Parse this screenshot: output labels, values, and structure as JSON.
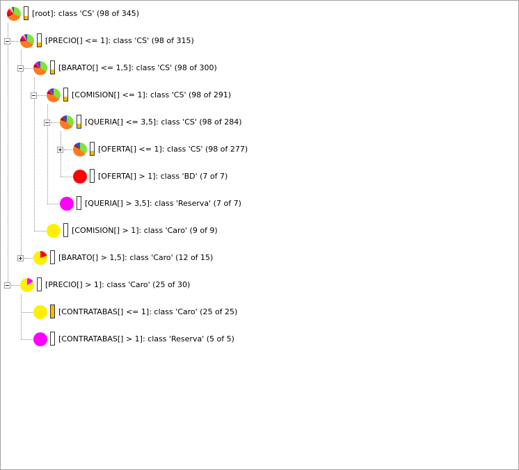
{
  "colors": {
    "CS": "#ffb800",
    "BD": "#ff0000",
    "Reserva": "#ff00ff",
    "Caro": "#ffef00",
    "pie_green": "#7fe33a",
    "pie_orange": "#ff7a1a",
    "pie_blue": "#3a48c8",
    "pie_darkred": "#8b1a1a"
  },
  "tree": {
    "nodes": [
      {
        "id": "root",
        "label": "[root]:  class 'CS' (98 of 345)",
        "pie_icon": "pie-chart-icon",
        "bar_level": 0.284,
        "bar_color": "#ffb800",
        "pie": [
          [
            "#7fe33a",
            0.31
          ],
          [
            "#ff7a1a",
            0.37
          ],
          [
            "#8b1a1a",
            0.05
          ],
          [
            "#ff0000",
            0.12
          ],
          [
            "#ff00ff",
            0.04
          ],
          [
            "#ffef00",
            0.06
          ],
          [
            "#3a48c8",
            0.05
          ]
        ]
      },
      {
        "id": "precio-le-1",
        "label": "[PRECIO[] <= 1]:  class 'CS' (98 of 315)",
        "pie_icon": "pie-chart-icon",
        "bar_level": 0.311,
        "bar_color": "#ffb800",
        "pie": [
          [
            "#7fe33a",
            0.32
          ],
          [
            "#ff7a1a",
            0.42
          ],
          [
            "#8b1a1a",
            0.06
          ],
          [
            "#ff0000",
            0.05
          ],
          [
            "#ff00ff",
            0.05
          ],
          [
            "#ffef00",
            0.03
          ],
          [
            "#3a48c8",
            0.07
          ]
        ]
      },
      {
        "id": "barato-le-15",
        "label": "[BARATO[] <= 1,5]:  class 'CS' (98 of 300)",
        "pie_icon": "pie-chart-icon",
        "bar_level": 0.327,
        "bar_color": "#ffb800",
        "pie": [
          [
            "#7fe33a",
            0.33
          ],
          [
            "#ff7a1a",
            0.44
          ],
          [
            "#8b1a1a",
            0.06
          ],
          [
            "#ff0000",
            0.03
          ],
          [
            "#ff00ff",
            0.05
          ],
          [
            "#3a48c8",
            0.09
          ]
        ]
      },
      {
        "id": "comision-le-1",
        "label": "[COMISION[] <= 1]:  class 'CS' (98 of 291)",
        "pie_icon": "pie-chart-icon",
        "bar_level": 0.337,
        "bar_color": "#ffb800",
        "pie": [
          [
            "#7fe33a",
            0.34
          ],
          [
            "#ff7a1a",
            0.45
          ],
          [
            "#8b1a1a",
            0.06
          ],
          [
            "#ff0000",
            0.03
          ],
          [
            "#ff00ff",
            0.03
          ],
          [
            "#3a48c8",
            0.09
          ]
        ]
      },
      {
        "id": "queria-le-35",
        "label": "[QUERIA[] <= 3,5]:  class 'CS' (98 of 284)",
        "pie_icon": "pie-chart-icon",
        "bar_level": 0.345,
        "bar_color": "#ffb800",
        "pie": [
          [
            "#7fe33a",
            0.35
          ],
          [
            "#ff7a1a",
            0.46
          ],
          [
            "#8b1a1a",
            0.06
          ],
          [
            "#ff0000",
            0.03
          ],
          [
            "#3a48c8",
            0.1
          ]
        ]
      },
      {
        "id": "oferta-le-1",
        "label": "[OFERTA[] <= 1]:  class 'CS' (98 of 277)",
        "pie_icon": "pie-chart-icon",
        "bar_level": 0.354,
        "bar_color": "#ffb800",
        "pie": [
          [
            "#7fe33a",
            0.36
          ],
          [
            "#ff7a1a",
            0.47
          ],
          [
            "#8b1a1a",
            0.06
          ],
          [
            "#3a48c8",
            0.11
          ]
        ]
      },
      {
        "id": "oferta-gt-1",
        "label": "[OFERTA[] > 1]:  class 'BD' (7 of 7)",
        "pie_icon": "pie-chart-icon",
        "bar_level": 0,
        "bar_color": "#ff0000",
        "pie": [
          [
            "#ff0000",
            1
          ]
        ]
      },
      {
        "id": "queria-gt-35",
        "label": "[QUERIA[] > 3,5]:  class 'Reserva' (7 of 7)",
        "pie_icon": "pie-chart-icon",
        "bar_level": 0,
        "bar_color": "#ff00ff",
        "pie": [
          [
            "#ff00ff",
            1
          ]
        ]
      },
      {
        "id": "comision-gt-1",
        "label": "[COMISION[] > 1]:  class 'Caro' (9 of 9)",
        "pie_icon": "pie-chart-icon",
        "bar_level": 0,
        "bar_color": "#ffef00",
        "pie": [
          [
            "#ffef00",
            1
          ]
        ]
      },
      {
        "id": "barato-gt-15",
        "label": "[BARATO[] > 1,5]:  class 'Caro' (12 of 15)",
        "pie_icon": "pie-chart-icon",
        "bar_level": 0,
        "bar_color": "#ffef00",
        "pie": [
          [
            "#ff0000",
            0.2
          ],
          [
            "#ffef00",
            0.8
          ]
        ]
      },
      {
        "id": "precio-gt-1",
        "label": "[PRECIO[] > 1]:  class 'Caro' (25 of 30)",
        "pie_icon": "pie-chart-icon",
        "bar_level": 0,
        "bar_color": "#ffef00",
        "pie": [
          [
            "#ff00ff",
            0.167
          ],
          [
            "#ffef00",
            0.833
          ]
        ]
      },
      {
        "id": "contratabas-le-1",
        "label": "[CONTRATABAS[] <= 1]:  class 'Caro' (25 of 25)",
        "pie_icon": "pie-chart-icon",
        "bar_level": 1,
        "bar_color": "#ffb800",
        "pie": [
          [
            "#ffef00",
            1
          ]
        ]
      },
      {
        "id": "contratabas-gt-1",
        "label": "[CONTRATABAS[] > 1]:  class 'Reserva' (5 of 5)",
        "pie_icon": "pie-chart-icon",
        "bar_level": 0,
        "bar_color": "#ff00ff",
        "pie": [
          [
            "#ff00ff",
            1
          ]
        ]
      }
    ]
  }
}
